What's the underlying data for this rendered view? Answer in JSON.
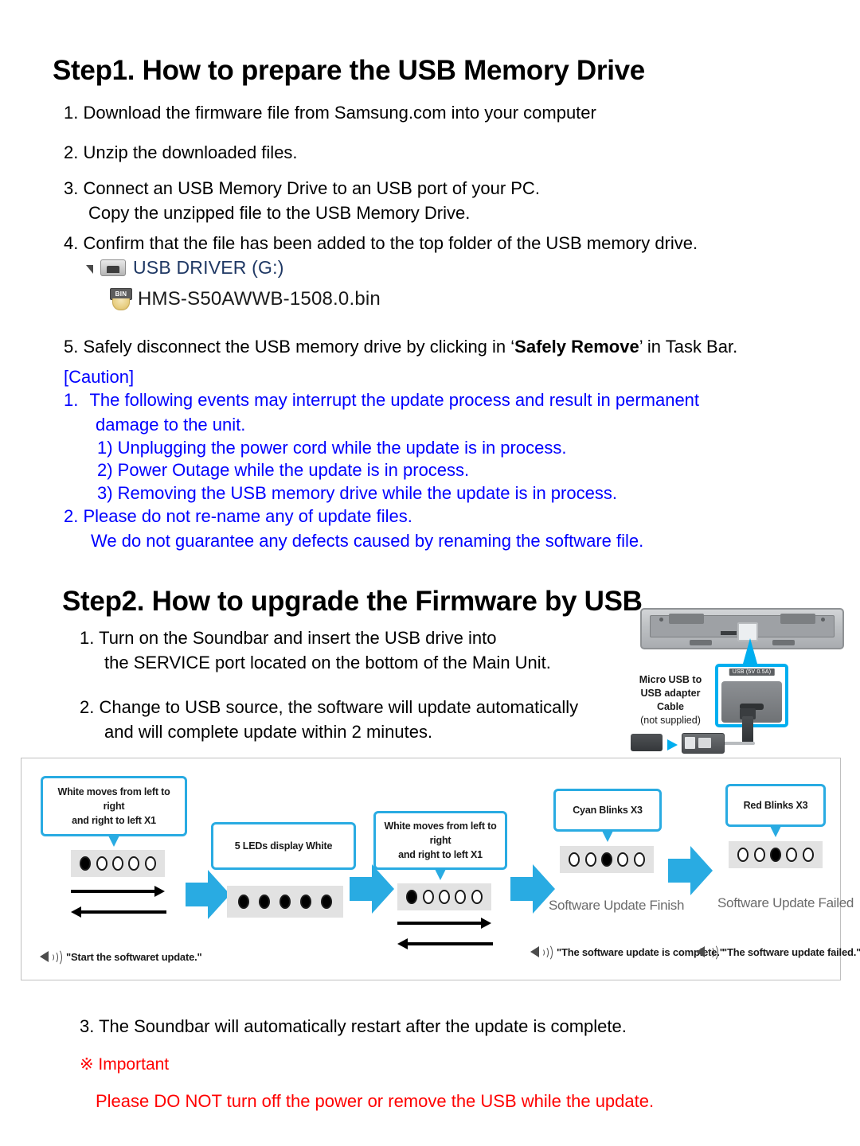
{
  "step1": {
    "title": "Step1. How to prepare the USB Memory Drive",
    "items": [
      {
        "num": "1.",
        "line1": "Download  the firmware file from Samsung.com into your computer"
      },
      {
        "num": "2.",
        "line1": "Unzip the downloaded files."
      },
      {
        "num": "3.",
        "line1": "Connect an USB Memory Drive to an USB port of your PC.",
        "line2": "Copy the unzipped file to the USB Memory Drive."
      },
      {
        "num": "4.",
        "line1": "Confirm that the file has been added to the top folder of the USB memory drive."
      }
    ],
    "explorer": {
      "drive_label": "USB DRIVER (G:)",
      "file_label": "HMS-S50AWWB-1508.0.bin",
      "file_icon_text": "BIN"
    },
    "item5": {
      "num": "5.",
      "pre": "Safely disconnect the USB memory drive by clicking in ‘",
      "bold": "Safely Remove",
      "post": "’ in Task Bar."
    },
    "caution": {
      "heading": "[Caution]",
      "item1": {
        "num": "1.",
        "line1": "The following events may interrupt the update process and result in permanent",
        "line2": "damage to the unit."
      },
      "sub_items": [
        "1) Unplugging the power cord while the update is in process.",
        "2) Power Outage while the update is in process.",
        "3) Removing the USB memory drive while the update is in process."
      ],
      "item2": {
        "num": "2.",
        "line1": "Please do not re-name any of update files.",
        "line2": "We do not guarantee any defects caused by renaming the software file."
      },
      "color": "#0000FF"
    }
  },
  "step2": {
    "title": "Step2. How to upgrade the Firmware by USB",
    "items": [
      {
        "num": "1.",
        "line1": "Turn on the Soundbar and insert the USB drive into",
        "line2": "the SERVICE port located on the bottom of the Main Unit."
      },
      {
        "num": "2.",
        "line1": "Change to USB source, the software will update automatically",
        "line2": "and will complete update within 2 minutes."
      }
    ],
    "soundbar_figure": {
      "port_label": "USB (5V 0.5A)",
      "cable_line1": "Micro USB to",
      "cable_line2": "USB adapter Cable",
      "cable_line3": "(not supplied)"
    },
    "item3": {
      "num": "3.",
      "line1": "The Soundbar will automatically restart after the update is complete."
    },
    "important": {
      "heading": "※ Important",
      "text": "Please DO NOT turn off the power or remove the USB while the update.",
      "color": "#FF0000"
    }
  },
  "flow_diagram": {
    "accent_color": "#29ABE2",
    "stages": [
      {
        "bubble_line1": "White moves from left to right",
        "bubble_line2": "and right to left X1",
        "leds": [
          1,
          0,
          0,
          0,
          0
        ],
        "has_motion_arrows": true,
        "status": "",
        "voice": "\"Start the softwaret update.\""
      },
      {
        "bubble_line1": "5 LEDs display White",
        "bubble_line2": "",
        "leds": [
          1,
          1,
          1,
          1,
          1
        ],
        "has_motion_arrows": false,
        "status": "",
        "voice": ""
      },
      {
        "bubble_line1": "White moves from left to right",
        "bubble_line2": "and right to left X1",
        "leds": [
          1,
          0,
          0,
          0,
          0
        ],
        "has_motion_arrows": true,
        "status": "",
        "voice": ""
      },
      {
        "bubble_line1": "Cyan Blinks X3",
        "bubble_line2": "",
        "leds": [
          0,
          0,
          1,
          0,
          0
        ],
        "has_motion_arrows": false,
        "status": "Software Update Finish",
        "voice": "\"The software update is complete.\""
      },
      {
        "bubble_line1": "Red Blinks X3",
        "bubble_line2": "",
        "leds": [
          0,
          0,
          1,
          0,
          0
        ],
        "has_motion_arrows": false,
        "status": "Software Update Failed",
        "voice": "\"The software update failed.\""
      }
    ]
  }
}
